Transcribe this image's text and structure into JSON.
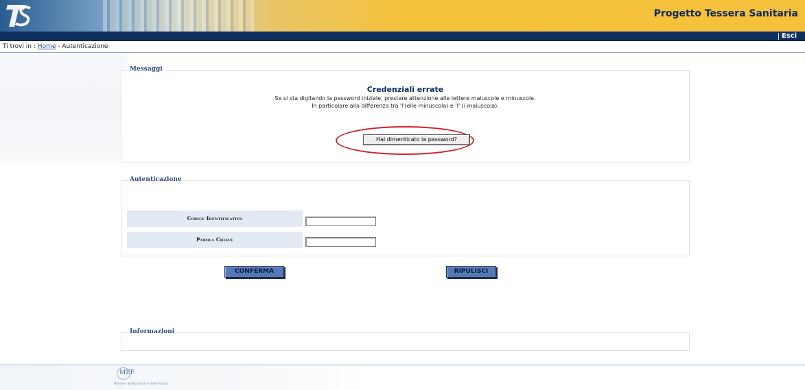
{
  "header": {
    "logo_text": "TS",
    "site_title": "Progetto Tessera Sanitaria",
    "exit_label": "Esci"
  },
  "breadcrumb": {
    "prefix": "Ti trovi in :",
    "home_link": "Home",
    "separator": " - ",
    "current": "Autenticazione"
  },
  "messages": {
    "legend": "Messaggi",
    "title": "Credenziali errate",
    "line1": "Se si sta digitando la password iniziale, prestare attenzione alle lettere maiuscole e minuscole.",
    "line2": "In particolare alla differenza tra 'l'(elle minuscola) e 'I' (i maiuscola).",
    "forgot_button": "Hai dimenticato la password?"
  },
  "auth": {
    "legend": "Autenticazione",
    "id_label": "Codice Identificativo",
    "id_value": "",
    "password_label": "Parola Chiave",
    "password_value": ""
  },
  "actions": {
    "confirm_label": "CONFERMA",
    "reset_label": "RIPULISCI"
  },
  "info": {
    "legend": "Informazioni"
  },
  "footer": {
    "logo_text": "MEF",
    "logo_subtitle": "Ministero dell'Economia e delle Finanze"
  },
  "colors": {
    "header_yellow": "#f6c13a",
    "navbar_blue": "#0f2f5f",
    "title_blue": "#0b2a5c",
    "highlight_red": "#d41f2a",
    "button_blue": "#5479b6",
    "label_bg": "#e3eaf3"
  }
}
